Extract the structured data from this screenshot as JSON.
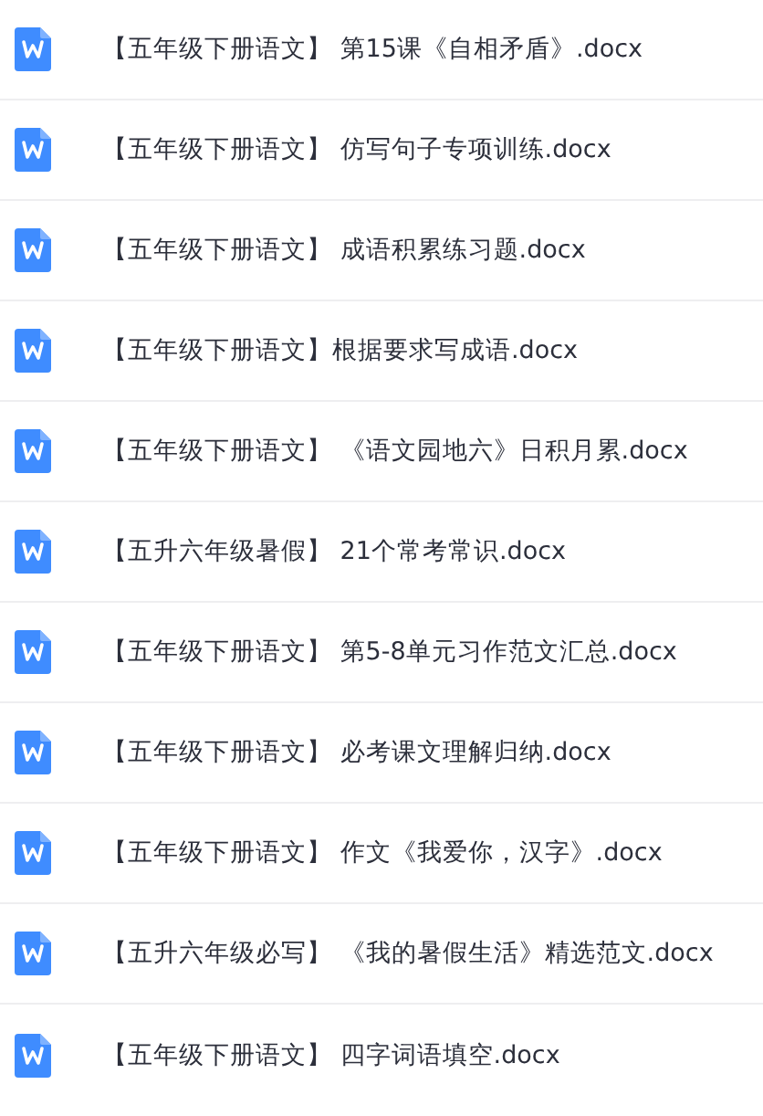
{
  "files": [
    {
      "name": "【五年级下册语文】 第15课《自相矛盾》.docx",
      "kind": "word"
    },
    {
      "name": "【五年级下册语文】 仿写句子专项训练.docx",
      "kind": "word"
    },
    {
      "name": "【五年级下册语文】 成语积累练习题.docx",
      "kind": "word"
    },
    {
      "name": "【五年级下册语文】根据要求写成语.docx",
      "kind": "word"
    },
    {
      "name": "【五年级下册语文】 《语文园地六》日积月累.docx",
      "kind": "word"
    },
    {
      "name": "【五升六年级暑假】 21个常考常识.docx",
      "kind": "word"
    },
    {
      "name": "【五年级下册语文】 第5-8单元习作范文汇总.docx",
      "kind": "word"
    },
    {
      "name": "【五年级下册语文】 必考课文理解归纳.docx",
      "kind": "word"
    },
    {
      "name": "【五年级下册语文】 作文《我爱你，汉字》.docx",
      "kind": "word"
    },
    {
      "name": "【五升六年级必写】 《我的暑假生活》精选范文.docx",
      "kind": "word"
    },
    {
      "name": "【五年级下册语文】 四字词语填空.docx",
      "kind": "word"
    }
  ]
}
